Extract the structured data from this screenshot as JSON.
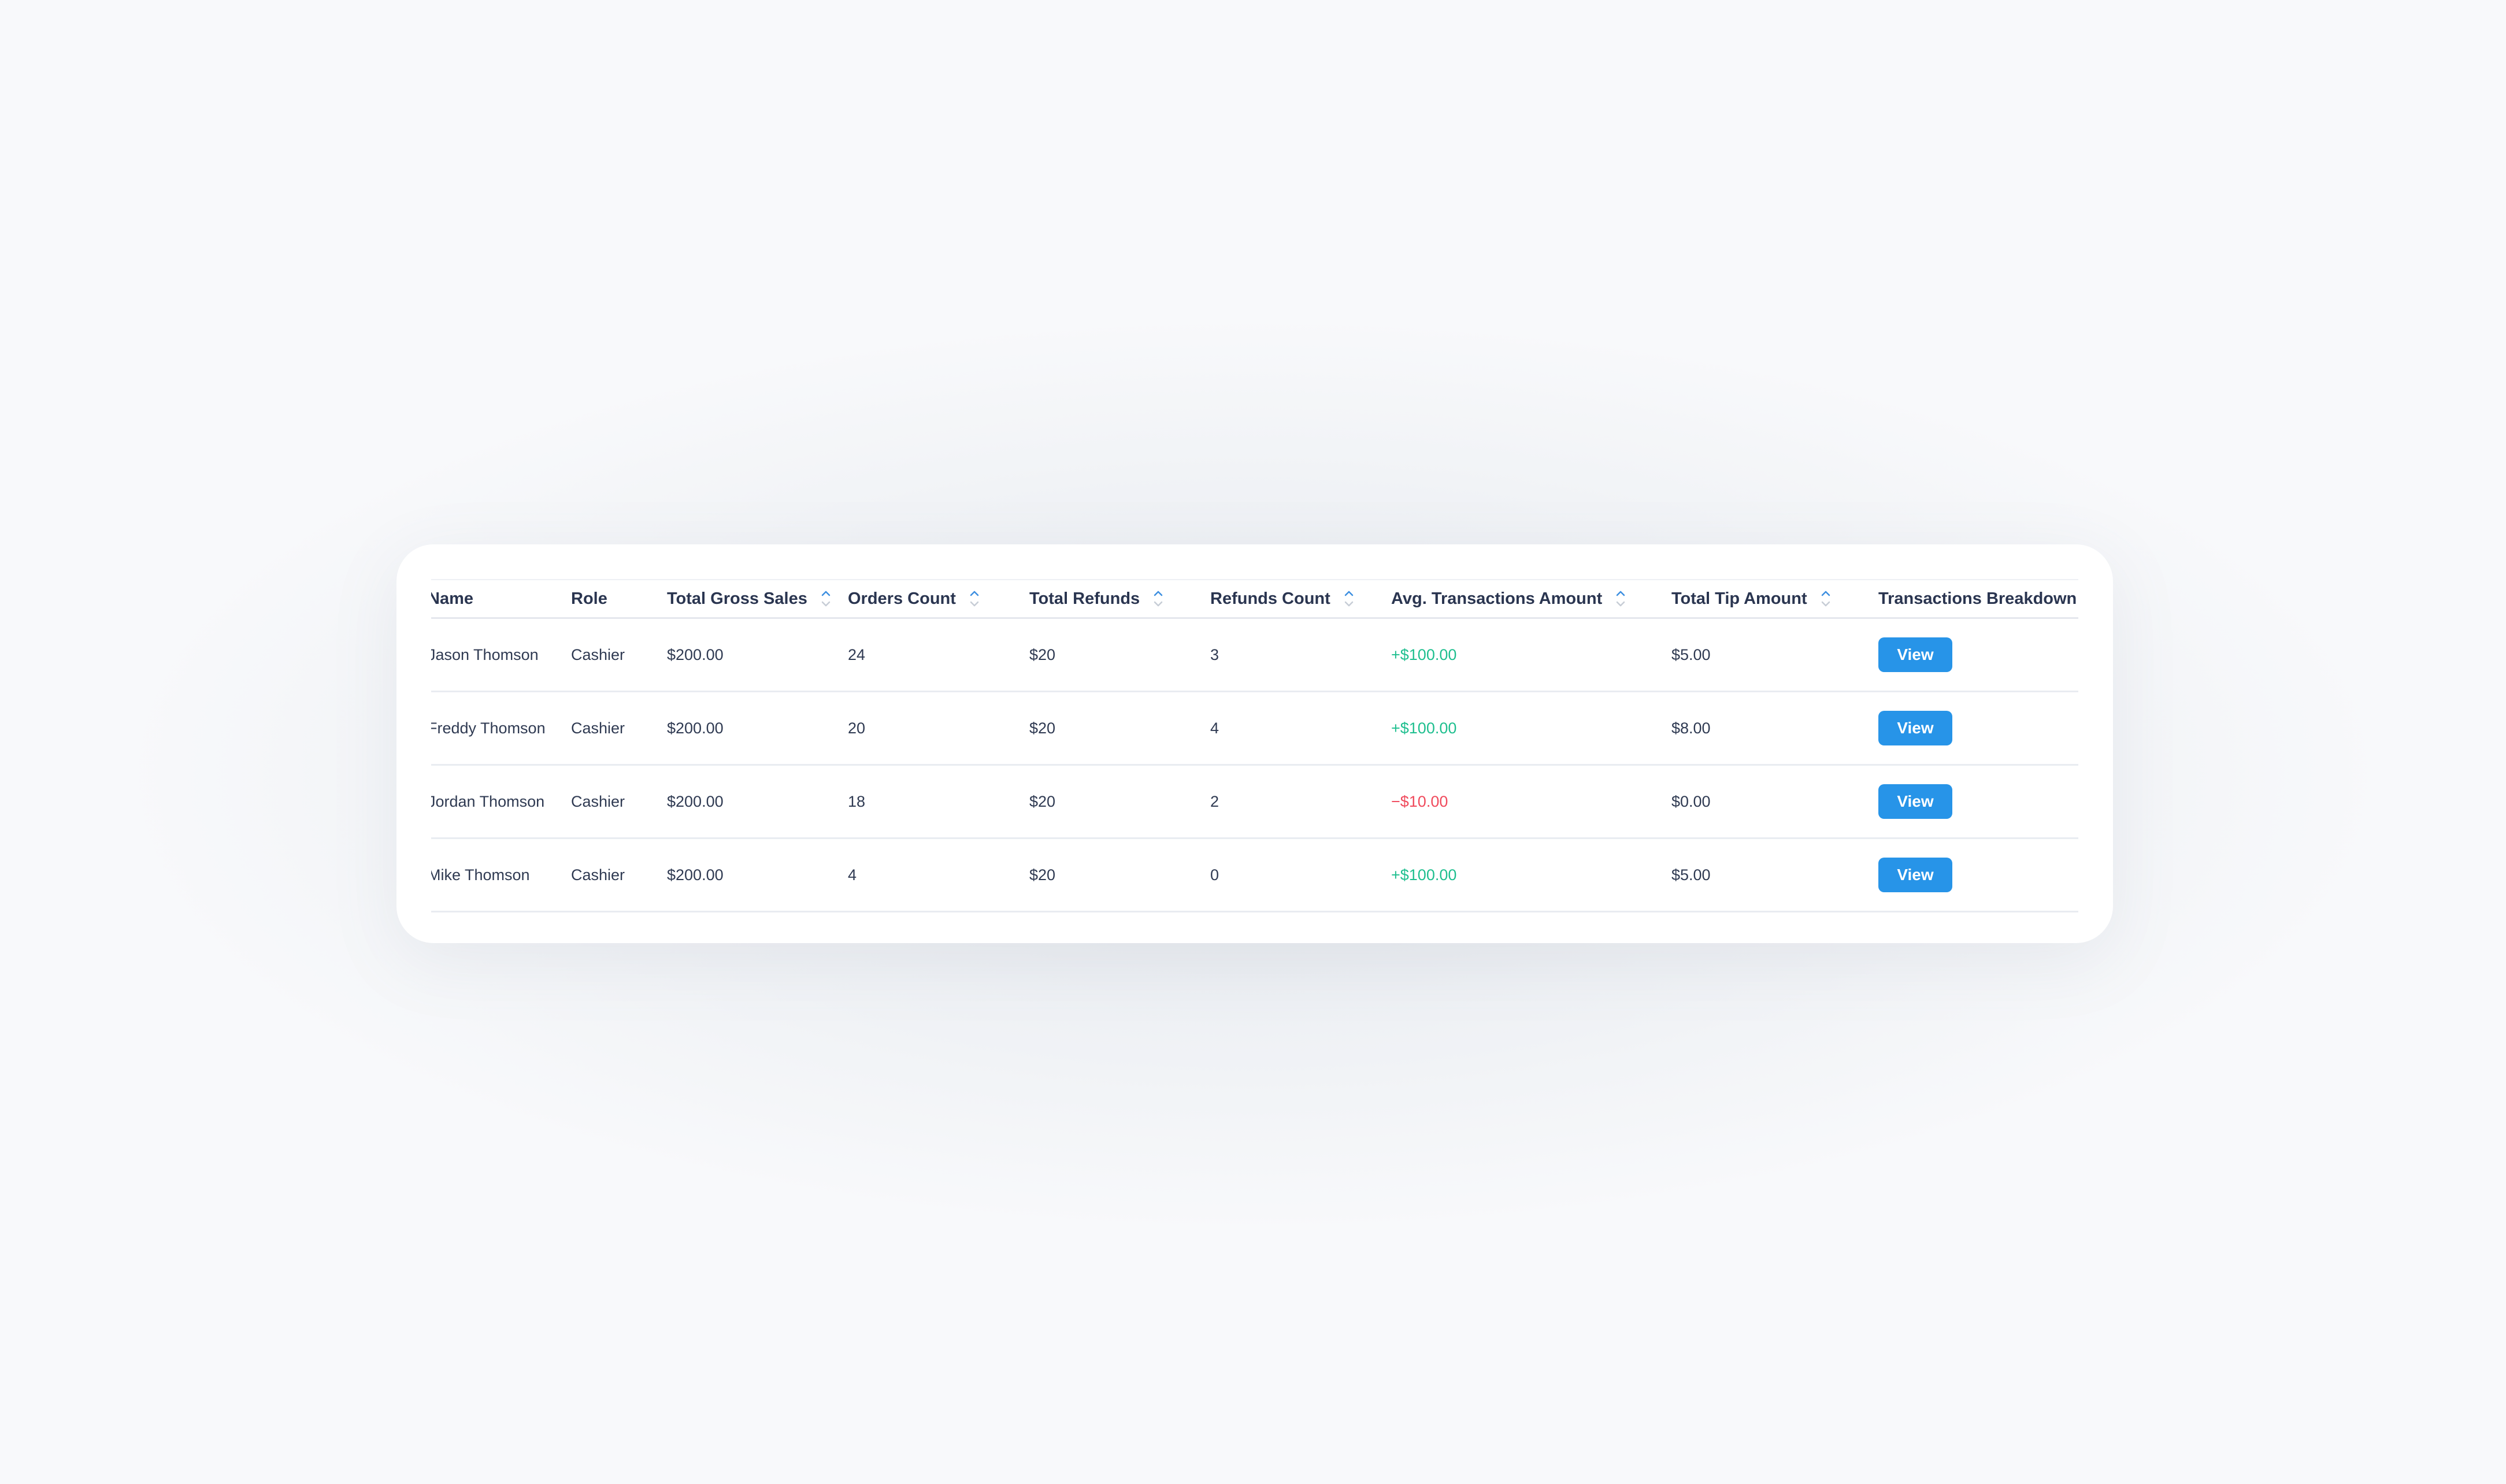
{
  "table": {
    "columns": [
      {
        "key": "name",
        "label": "Name",
        "sortable": false
      },
      {
        "key": "role",
        "label": "Role",
        "sortable": false
      },
      {
        "key": "gross",
        "label": "Total Gross Sales",
        "sortable": true
      },
      {
        "key": "orders",
        "label": "Orders Count",
        "sortable": true
      },
      {
        "key": "refunds",
        "label": "Total Refunds",
        "sortable": true
      },
      {
        "key": "refunds_count",
        "label": "Refunds Count",
        "sortable": true
      },
      {
        "key": "avg",
        "label": "Avg. Transactions Amount",
        "sortable": true
      },
      {
        "key": "tip",
        "label": "Total Tip Amount",
        "sortable": true
      },
      {
        "key": "breakdown",
        "label": "Transactions Breakdown",
        "sortable": false
      }
    ],
    "rows": [
      {
        "name": "Jason Thomson",
        "role": "Cashier",
        "gross": "$200.00",
        "orders": "24",
        "refunds": "$20",
        "refunds_count": "3",
        "avg": "+$100.00",
        "avg_trend": "positive",
        "tip": "$5.00",
        "action": "View"
      },
      {
        "name": "Freddy Thomson",
        "role": "Cashier",
        "gross": "$200.00",
        "orders": "20",
        "refunds": "$20",
        "refunds_count": "4",
        "avg": "+$100.00",
        "avg_trend": "positive",
        "tip": "$8.00",
        "action": "View"
      },
      {
        "name": "Jordan Thomson",
        "role": "Cashier",
        "gross": "$200.00",
        "orders": "18",
        "refunds": "$20",
        "refunds_count": "2",
        "avg": "−$10.00",
        "avg_trend": "negative",
        "tip": "$0.00",
        "action": "View"
      },
      {
        "name": "Mike Thomson",
        "role": "Cashier",
        "gross": "$200.00",
        "orders": "4",
        "refunds": "$20",
        "refunds_count": "0",
        "avg": "+$100.00",
        "avg_trend": "positive",
        "tip": "$5.00",
        "action": "View"
      }
    ]
  },
  "colors": {
    "accent": "#2794e8",
    "positive": "#1fbf8f",
    "negative": "#f04a5c",
    "text": "#2f3a52",
    "background": "#f8f9fb"
  },
  "icons": {
    "sort": "sort-arrows-icon"
  }
}
